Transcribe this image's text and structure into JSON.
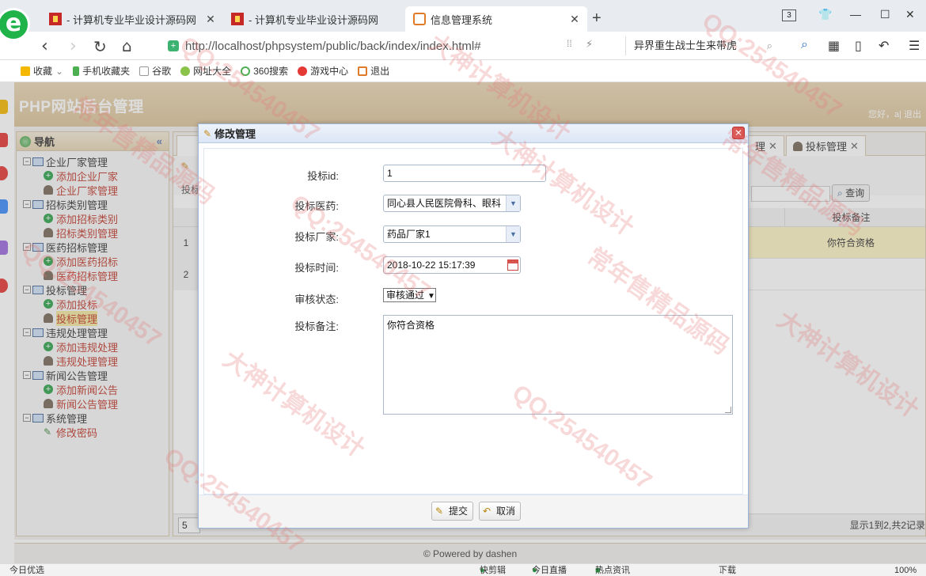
{
  "browser": {
    "tabs": [
      {
        "title": "- 计算机专业毕业设计源码网",
        "active": false
      },
      {
        "title": "- 计算机专业毕业设计源码网",
        "active": false
      },
      {
        "title": "信息管理系统",
        "active": true
      }
    ],
    "new_tab": "+",
    "tab_count": "3",
    "url": "http://localhost/phpsystem/public/back/index/index.html#",
    "search_text": "异界重生战士生来带虎",
    "bookmarks": [
      "收藏",
      "手机收藏夹",
      "谷歌",
      "网址大全",
      "360搜索",
      "游戏中心",
      "退出"
    ],
    "status": {
      "left": "今日优选",
      "items": [
        "快剪辑",
        "今日直播",
        "热点资讯",
        "下载"
      ],
      "zoom": "100%"
    }
  },
  "app": {
    "title": "PHP网站后台管理",
    "welcome": "您好，a| 退出",
    "nav": {
      "title": "导航",
      "collapse_icon": "«",
      "groups": [
        {
          "label": "企业厂家管理",
          "children": [
            {
              "label": "添加企业厂家",
              "icon": "add"
            },
            {
              "label": "企业厂家管理",
              "icon": "user"
            }
          ]
        },
        {
          "label": "招标类别管理",
          "children": [
            {
              "label": "添加招标类别",
              "icon": "add"
            },
            {
              "label": "招标类别管理",
              "icon": "user"
            }
          ]
        },
        {
          "label": "医药招标管理",
          "children": [
            {
              "label": "添加医药招标",
              "icon": "add"
            },
            {
              "label": "医药招标管理",
              "icon": "user"
            }
          ]
        },
        {
          "label": "投标管理",
          "children": [
            {
              "label": "添加投标",
              "icon": "add"
            },
            {
              "label": "投标管理",
              "icon": "user",
              "selected": true
            }
          ]
        },
        {
          "label": "违规处理管理",
          "children": [
            {
              "label": "添加违规处理",
              "icon": "add"
            },
            {
              "label": "违规处理管理",
              "icon": "user"
            }
          ]
        },
        {
          "label": "新闻公告管理",
          "children": [
            {
              "label": "添加新闻公告",
              "icon": "add"
            },
            {
              "label": "新闻公告管理",
              "icon": "user"
            }
          ]
        },
        {
          "label": "系统管理",
          "children": [
            {
              "label": "修改密码",
              "icon": "pencil"
            }
          ]
        }
      ]
    },
    "work_tabs": [
      {
        "label": "理",
        "closable": true
      },
      {
        "label": "投标管理",
        "closable": true,
        "active": true
      }
    ],
    "toolbar_label": "投标",
    "query_label": "查询",
    "grid": {
      "note_header": "投标备注",
      "rows": [
        {
          "num": "1",
          "note": "你符合资格",
          "highlight": true
        },
        {
          "num": "2",
          "note": "",
          "highlight": false
        }
      ],
      "page_size": "5",
      "page_info": "显示1到2,共2记录"
    },
    "footer": "© Powered by dashen"
  },
  "dialog": {
    "title": "修改管理",
    "close_icon": "✕",
    "fields": {
      "bid_id_label": "投标id:",
      "bid_id_value": "1",
      "medicine_label": "投标医药:",
      "medicine_value": "同心县人民医院骨科、眼科",
      "vendor_label": "投标厂家:",
      "vendor_value": "药品厂家1",
      "time_label": "投标时间:",
      "time_value": "2018-10-22 15:17:39",
      "status_label": "审核状态:",
      "status_value": "审核通过",
      "note_label": "投标备注:",
      "note_value": "你符合资格"
    },
    "submit_label": "提交",
    "cancel_label": "取消"
  },
  "watermarks": [
    "QQ:254540457",
    "大神计算机设计",
    "常年售精品源码"
  ],
  "colors": {
    "header": "#dcc49a",
    "nav_link": "#c0392b",
    "selection": "#f5e79e",
    "row_highlight": "#fcf3c4",
    "dialog_border": "#9db7dc"
  }
}
